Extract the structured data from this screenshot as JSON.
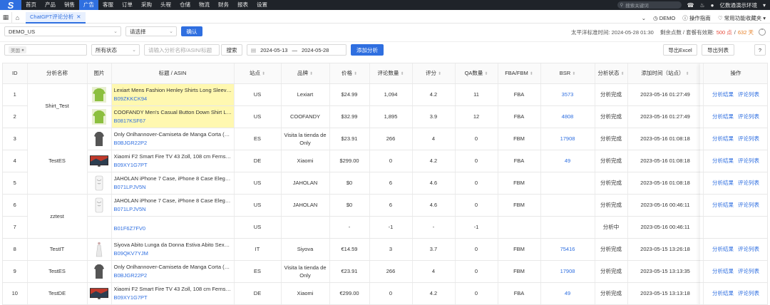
{
  "nav": {
    "logo": "S",
    "items": [
      "首页",
      "产品",
      "销售",
      "广告",
      "客服",
      "订单",
      "采购",
      "头程",
      "仓储",
      "物流",
      "财务",
      "报表",
      "设置"
    ],
    "active_index": 3,
    "search_placeholder": "搜索关键词",
    "user": "亿数通演示环境"
  },
  "tabbar": {
    "tab_label": "ChatGPT评论分析",
    "demo": "DEMO",
    "guide": "操作指南",
    "common": "常用功能收藏夹"
  },
  "filters": {
    "account": "DEMO_US",
    "select2": "请选择",
    "confirm": "确认",
    "time_label": "太平洋标准时间: 2024-05-28 01:30",
    "remain_label": "剩余点数 / 套餐有效期:",
    "points": "500 点",
    "slash": "/",
    "days": "632 天",
    "site_chip": "美国",
    "status": "所有状态",
    "keyword_placeholder": "请输入分析名称/ASIN/标题",
    "search": "搜索",
    "date_start": "2024-05-13",
    "date_sep": "—",
    "date_end": "2024-05-28",
    "add_analysis": "添加分析",
    "export_excel": "导出Excel",
    "export_list": "导出列表"
  },
  "table": {
    "headers": [
      "ID",
      "分析名称",
      "图片",
      "标题 / ASIN",
      "站点",
      "品牌",
      "价格",
      "评论数量",
      "评分",
      "QA数量",
      "FBA/FBM",
      "BSR",
      "分析状态",
      "添加时间（站点）",
      "操作"
    ],
    "op_result": "分析结果",
    "op_reviews": "评论列表",
    "groups": [
      {
        "name": "Shirt_Test",
        "rows": [
          {
            "id": "1",
            "img": "shirt-green",
            "title": "Lexiart Mens Fashion Henley Shirts Long Sleeve Butt...",
            "asin": "B09ZKKCK94",
            "hl": true,
            "site": "US",
            "brand": "Lexiart",
            "price": "$24.99",
            "reviews": "1,094",
            "rating": "4.2",
            "qa": "11",
            "fba": "FBA",
            "bsr": "3573",
            "status": "分析完成",
            "time": "2023-05-16 01:27:49",
            "ops": true
          },
          {
            "id": "2",
            "img": "shirt-green",
            "title": "COOFANDY Men's Casual Button Down Shirt Long ...",
            "asin": "B0817KSF67",
            "hl": true,
            "site": "US",
            "brand": "COOFANDY",
            "price": "$32.99",
            "reviews": "1,895",
            "rating": "3.9",
            "qa": "12",
            "fba": "FBA",
            "bsr": "4808",
            "status": "分析完成",
            "time": "2023-05-16 01:27:49",
            "ops": true
          }
        ]
      },
      {
        "name": "TestES",
        "rows": [
          {
            "id": "3",
            "img": "tshirt-dark",
            "title": "Only Onlhannover-Camiseta de Manga Corta (Talla ...",
            "asin": "B0BJGR22P2",
            "hl": false,
            "site": "ES",
            "brand": "Visita la tienda de Only",
            "price": "$23.91",
            "reviews": "266",
            "rating": "4",
            "qa": "0",
            "fba": "FBM",
            "bsr": "17908",
            "status": "分析完成",
            "time": "2023-05-16 01:08:18",
            "ops": true
          },
          {
            "id": "4",
            "img": "tv",
            "title": "Xiaomi F2 Smart Fire TV 43 Zoll, 108 cm Fernseher ...",
            "asin": "B09XY1G7PT",
            "hl": false,
            "site": "DE",
            "brand": "Xiaomi",
            "price": "$299.00",
            "reviews": "0",
            "rating": "4.2",
            "qa": "0",
            "fba": "FBA",
            "bsr": "49",
            "status": "分析完成",
            "time": "2023-05-16 01:08:18",
            "ops": true
          },
          {
            "id": "5",
            "img": "phonecase",
            "title": "JAHOLAN iPhone 7 Case, iPhone 8 Case Elegant W...",
            "asin": "B071LPJV5N",
            "hl": false,
            "site": "US",
            "brand": "JAHOLAN",
            "price": "$0",
            "reviews": "6",
            "rating": "4.6",
            "qa": "0",
            "fba": "FBM",
            "bsr": "",
            "status": "分析完成",
            "time": "2023-05-16 01:08:18",
            "ops": true
          }
        ]
      },
      {
        "name": "zztest",
        "rows": [
          {
            "id": "6",
            "img": "phonecase",
            "title": "JAHOLAN iPhone 7 Case, iPhone 8 Case Elegant W...",
            "asin": "B071LPJV5N",
            "hl": false,
            "site": "US",
            "brand": "JAHOLAN",
            "price": "$0",
            "reviews": "6",
            "rating": "4.6",
            "qa": "0",
            "fba": "FBM",
            "bsr": "",
            "status": "分析完成",
            "time": "2023-05-16 00:46:11",
            "ops": true
          },
          {
            "id": "7",
            "img": "",
            "title": "",
            "asin": "B01F6Z7FV0",
            "hl": false,
            "site": "US",
            "brand": "",
            "price": "-",
            "reviews": "-1",
            "rating": "-",
            "qa": "-1",
            "fba": "",
            "bsr": "",
            "status": "分析中",
            "time": "2023-05-16 00:46:11",
            "ops": false
          }
        ]
      },
      {
        "name": "TestIT",
        "rows": [
          {
            "id": "8",
            "img": "dress",
            "title": "Siyova Abito Lunga da Donna Estiva Abito Sexy Donn...",
            "asin": "B09QKV7YJM",
            "hl": false,
            "site": "IT",
            "brand": "Siyova",
            "price": "€14.59",
            "reviews": "3",
            "rating": "3.7",
            "qa": "0",
            "fba": "FBM",
            "bsr": "75416",
            "status": "分析完成",
            "time": "2023-05-15 13:26:18",
            "ops": true
          }
        ]
      },
      {
        "name": "TestES",
        "rows": [
          {
            "id": "9",
            "img": "tshirt-dark",
            "title": "Only Onlhannover-Camiseta de Manga Corta (Talla ...",
            "asin": "B0BJGR22P2",
            "hl": false,
            "site": "ES",
            "brand": "Visita la tienda de Only",
            "price": "€23.91",
            "reviews": "266",
            "rating": "4",
            "qa": "0",
            "fba": "FBM",
            "bsr": "17908",
            "status": "分析完成",
            "time": "2023-05-15 13:13:35",
            "ops": true
          }
        ]
      },
      {
        "name": "TestDE",
        "rows": [
          {
            "id": "10",
            "img": "tv",
            "title": "Xiaomi F2 Smart Fire TV 43 Zoll, 108 cm Fernseher ...",
            "asin": "B09XY1G7PT",
            "hl": false,
            "site": "DE",
            "brand": "Xiaomi",
            "price": "€299.00",
            "reviews": "0",
            "rating": "4.2",
            "qa": "0",
            "fba": "FBA",
            "bsr": "49",
            "status": "分析完成",
            "time": "2023-05-15 13:13:18",
            "ops": true
          }
        ]
      }
    ]
  }
}
